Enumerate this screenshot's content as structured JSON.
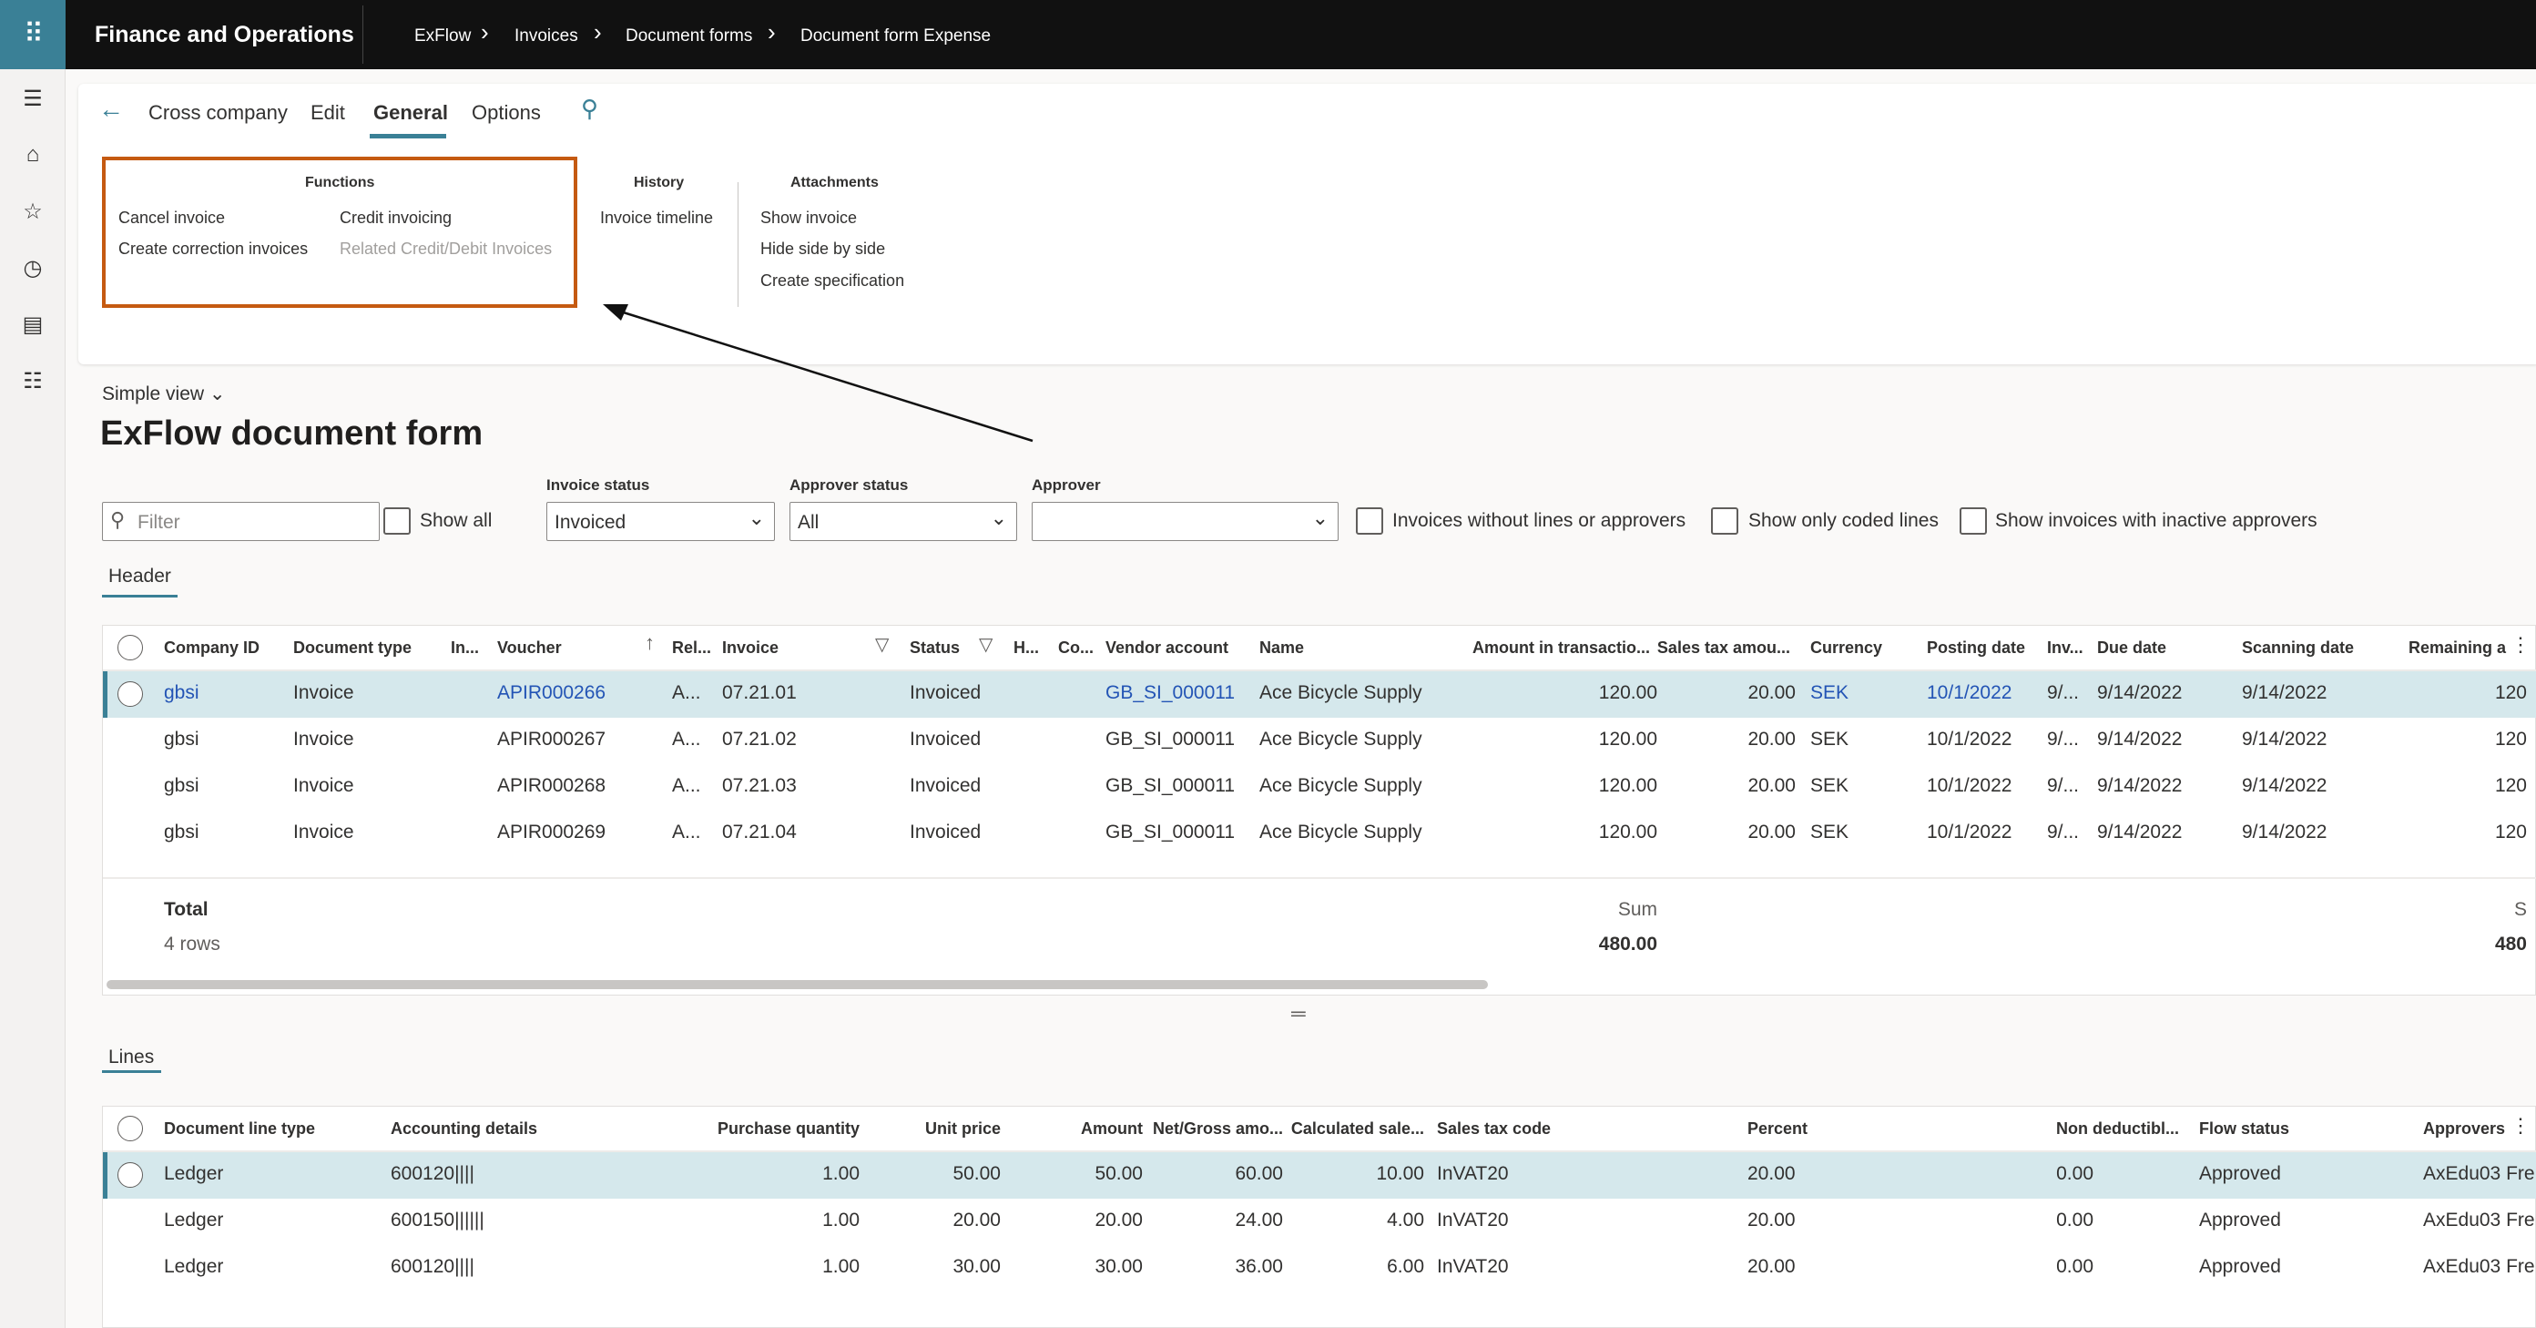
{
  "topbar": {
    "app_title": "Finance and Operations",
    "breadcrumbs": [
      "ExFlow",
      "Invoices",
      "Document forms",
      "Document form Expense"
    ],
    "waffle_icon": "waffle-icon"
  },
  "rail": {
    "icons": [
      "hamburger-icon",
      "home-icon",
      "star-icon",
      "clock-icon",
      "workspace-icon",
      "list-icon"
    ]
  },
  "actionpane": {
    "tabs": [
      "Cross company",
      "Edit",
      "General",
      "Options"
    ],
    "active_tab": "General",
    "groups": {
      "functions": {
        "title": "Functions",
        "items": [
          "Cancel invoice",
          "Create correction invoices",
          "Credit invoicing",
          "Related Credit/Debit Invoices"
        ],
        "disabled": [
          "Related Credit/Debit Invoices"
        ]
      },
      "history": {
        "title": "History",
        "items": [
          "Invoice timeline"
        ]
      },
      "attachments": {
        "title": "Attachments",
        "items": [
          "Show invoice",
          "Hide side by side",
          "Create specification"
        ]
      }
    },
    "highlight_color": "#c55a11"
  },
  "page": {
    "view": "Simple view",
    "title": "ExFlow document form"
  },
  "filters": {
    "filter_placeholder": "Filter",
    "show_all": "Show all",
    "invoice_status": {
      "label": "Invoice status",
      "value": "Invoiced"
    },
    "approver_status": {
      "label": "Approver status",
      "value": "All"
    },
    "approver": {
      "label": "Approver",
      "value": ""
    },
    "checkboxes": [
      "Invoices without lines or approvers",
      "Show only coded lines",
      "Show invoices with inactive approvers"
    ]
  },
  "header": {
    "tab": "Header",
    "columns": [
      "Company ID",
      "Document type",
      "In...",
      "Voucher",
      "Rel...",
      "Invoice",
      "Status",
      "H...",
      "Co...",
      "Vendor account",
      "Name",
      "Amount in transactio...",
      "Sales tax amou...",
      "Currency",
      "Posting date",
      "Inv...",
      "Due date",
      "Scanning date",
      "Remaining a"
    ],
    "rows": [
      [
        "gbsi",
        "Invoice",
        "APIR000266",
        "A...",
        "07.21.01",
        "Invoiced",
        "GB_SI_000011",
        "Ace Bicycle Supply",
        "120.00",
        "20.00",
        "SEK",
        "10/1/2022",
        "9/...",
        "9/14/2022",
        "9/14/2022",
        "120"
      ],
      [
        "gbsi",
        "Invoice",
        "APIR000267",
        "A...",
        "07.21.02",
        "Invoiced",
        "GB_SI_000011",
        "Ace Bicycle Supply",
        "120.00",
        "20.00",
        "SEK",
        "10/1/2022",
        "9/...",
        "9/14/2022",
        "9/14/2022",
        "120"
      ],
      [
        "gbsi",
        "Invoice",
        "APIR000268",
        "A...",
        "07.21.03",
        "Invoiced",
        "GB_SI_000011",
        "Ace Bicycle Supply",
        "120.00",
        "20.00",
        "SEK",
        "10/1/2022",
        "9/...",
        "9/14/2022",
        "9/14/2022",
        "120"
      ],
      [
        "gbsi",
        "Invoice",
        "APIR000269",
        "A...",
        "07.21.04",
        "Invoiced",
        "GB_SI_000011",
        "Ace Bicycle Supply",
        "120.00",
        "20.00",
        "SEK",
        "10/1/2022",
        "9/...",
        "9/14/2022",
        "9/14/2022",
        "120"
      ]
    ],
    "total": {
      "label": "Total",
      "rows": "4 rows",
      "sum_label": "Sum",
      "sum": "480.00",
      "sum_label_2": "S",
      "sum_2": "480"
    }
  },
  "lines": {
    "tab": "Lines",
    "columns": [
      "Document line type",
      "Accounting details",
      "Purchase quantity",
      "Unit price",
      "Amount",
      "Net/Gross amo...",
      "Calculated sale...",
      "Sales tax code",
      "Percent",
      "Non deductibl...",
      "Flow status",
      "Approvers"
    ],
    "rows": [
      [
        "Ledger",
        "600120||||",
        "1.00",
        "50.00",
        "50.00",
        "60.00",
        "10.00",
        "InVAT20",
        "20.00",
        "0.00",
        "Approved",
        "AxEdu03 Fre"
      ],
      [
        "Ledger",
        "600150||||||",
        "1.00",
        "20.00",
        "20.00",
        "24.00",
        "4.00",
        "InVAT20",
        "20.00",
        "0.00",
        "Approved",
        "AxEdu03 Fre"
      ],
      [
        "Ledger",
        "600120||||",
        "1.00",
        "30.00",
        "30.00",
        "36.00",
        "6.00",
        "InVAT20",
        "20.00",
        "0.00",
        "Approved",
        "AxEdu03 Fre"
      ]
    ]
  },
  "colors": {
    "accent": "#3a8096",
    "link": "#2354b5",
    "selected_row": "#d5e8ec",
    "topbar": "#111111"
  }
}
